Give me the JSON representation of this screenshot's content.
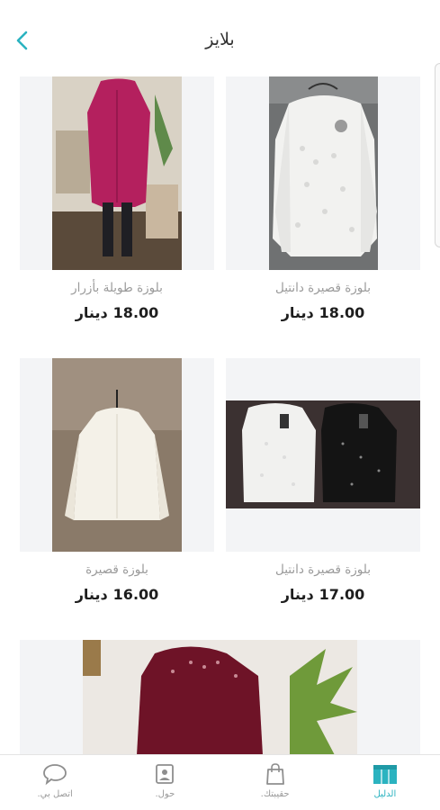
{
  "header": {
    "title": "بلايز",
    "back_icon": "chevron-left-icon"
  },
  "colors": {
    "accent": "#2bb3c0",
    "tile_bg": "#f3f4f6",
    "muted": "#9a9a9a"
  },
  "products": [
    {
      "name": "بلوزة قصيرة دانتيل",
      "price": "18.00",
      "currency": "دينار"
    },
    {
      "name": "بلوزة طويلة بأزرار",
      "price": "18.00",
      "currency": "دينار"
    },
    {
      "name": "بلوزة قصيرة دانتيل",
      "price": "17.00",
      "currency": "دينار"
    },
    {
      "name": "بلوزة قصيرة",
      "price": "16.00",
      "currency": "دينار"
    }
  ],
  "bottom_nav": {
    "items": [
      {
        "label": "اتصل بي.",
        "icon": "chat-bubble-icon"
      },
      {
        "label": "حول.",
        "icon": "profile-card-icon"
      },
      {
        "label": "حقيبتك.",
        "icon": "shopping-bag-icon"
      },
      {
        "label": "الدليل",
        "icon": "catalog-icon",
        "active": true
      }
    ]
  }
}
